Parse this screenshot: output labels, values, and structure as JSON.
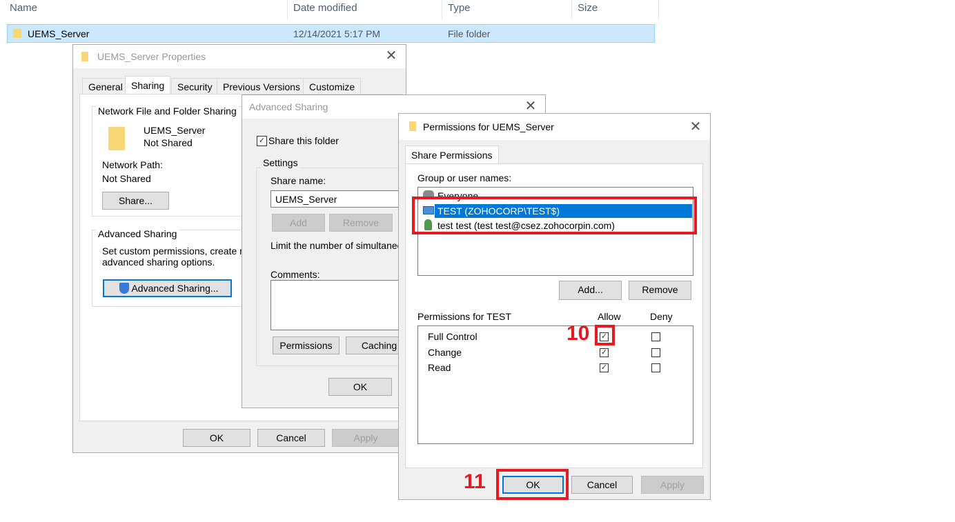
{
  "explorer": {
    "columns": {
      "name": "Name",
      "date": "Date modified",
      "type": "Type",
      "size": "Size"
    },
    "row": {
      "name": "UEMS_Server",
      "date": "12/14/2021 5:17 PM",
      "type": "File folder"
    }
  },
  "properties": {
    "title": "UEMS_Server Properties",
    "tabs": [
      "General",
      "Sharing",
      "Security",
      "Previous Versions",
      "Customize"
    ],
    "network_group": "Network File and Folder Sharing",
    "folder_name": "UEMS_Server",
    "folder_state": "Not Shared",
    "network_path_label": "Network Path:",
    "network_path_value": "Not Shared",
    "share_button": "Share...",
    "advanced_group": "Advanced Sharing",
    "advanced_desc_1": "Set custom permissions, create mu",
    "advanced_desc_2": "advanced sharing options.",
    "advanced_button": "Advanced Sharing...",
    "ok": "OK",
    "cancel": "Cancel",
    "apply": "Apply"
  },
  "advanced": {
    "title": "Advanced Sharing",
    "share_checkbox": "Share this folder",
    "settings_group": "Settings",
    "share_name_label": "Share name:",
    "share_name_value": "UEMS_Server",
    "add": "Add",
    "remove": "Remove",
    "limit_text": "Limit the number of simultaneou",
    "comments_label": "Comments:",
    "permissions_button": "Permissions",
    "caching_button": "Caching",
    "ok": "OK"
  },
  "permissions": {
    "title": "Permissions for UEMS_Server",
    "tab": "Share Permissions",
    "group_label": "Group or user names:",
    "users": [
      "Everyone",
      "TEST (ZOHOCORP\\TEST$)",
      "test test (test test@csez.zohocorpin.com)"
    ],
    "add": "Add...",
    "remove": "Remove",
    "perm_label": "Permissions for TEST",
    "allow": "Allow",
    "deny": "Deny",
    "perms": [
      {
        "name": "Full Control",
        "allow": true,
        "deny": false
      },
      {
        "name": "Change",
        "allow": true,
        "deny": false
      },
      {
        "name": "Read",
        "allow": true,
        "deny": false
      }
    ],
    "ok": "OK",
    "cancel": "Cancel",
    "apply": "Apply"
  },
  "annotations": {
    "step10": "10",
    "step11": "11"
  },
  "colors": {
    "highlight": "#e51b24",
    "selection": "#0078d7"
  }
}
